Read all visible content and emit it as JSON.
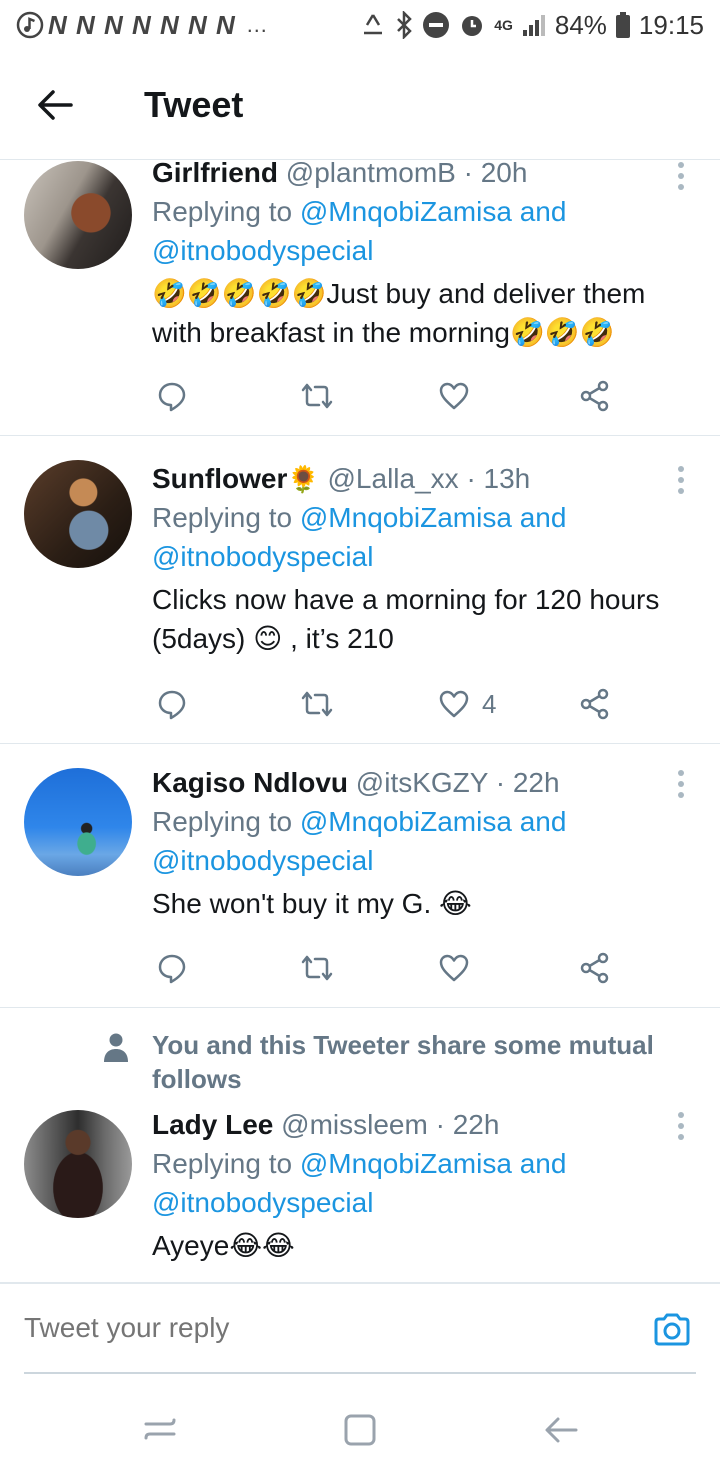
{
  "status_bar": {
    "notification_letters": "N N N N N N N",
    "more": "…",
    "signal": "4G",
    "battery": "84%",
    "time": "19:15"
  },
  "header": {
    "title": "Tweet"
  },
  "tweets": [
    {
      "name": "Girlfriend",
      "handle": "@plantmomB",
      "time": "· 20h",
      "replying_prefix": "Replying to",
      "replying_user1": "@MnqobiZamisa",
      "replying_and": "and",
      "replying_user2": "@itnobodyspecial",
      "text": "🤣🤣🤣🤣🤣Just buy and deliver them with breakfast in the morning🤣🤣🤣",
      "like_count": ""
    },
    {
      "name": "Sunflower",
      "name_emoji": "🌻",
      "handle": "@Lalla_xx",
      "time": "· 13h",
      "replying_prefix": "Replying to",
      "replying_user1": "@MnqobiZamisa",
      "replying_and": "and",
      "replying_user2": "@itnobodyspecial",
      "text": "Clicks now have a morning for 120 hours (5days) 😊 , it’s 210",
      "like_count": "4"
    },
    {
      "name": "Kagiso Ndlovu",
      "handle": "@itsKGZY",
      "time": "· 22h",
      "replying_prefix": "Replying to",
      "replying_user1": "@MnqobiZamisa",
      "replying_and": "and",
      "replying_user2": "@itnobodyspecial",
      "text": "She won't buy it my G. 😂",
      "like_count": ""
    },
    {
      "name": "Lady Lee",
      "handle": "@missleem",
      "time": "· 22h",
      "replying_prefix": "Replying to",
      "replying_user1": "@MnqobiZamisa",
      "replying_and": "and",
      "replying_user2": "@itnobodyspecial",
      "text": "Ayeye😂😂",
      "like_count": ""
    }
  ],
  "mutual_follows": {
    "text": "You and this Tweeter share some mutual follows"
  },
  "reply_bar": {
    "placeholder": "Tweet your reply"
  },
  "colors": {
    "link": "#1b95e0",
    "secondary": "#657786",
    "divider": "#e1e8ed"
  }
}
